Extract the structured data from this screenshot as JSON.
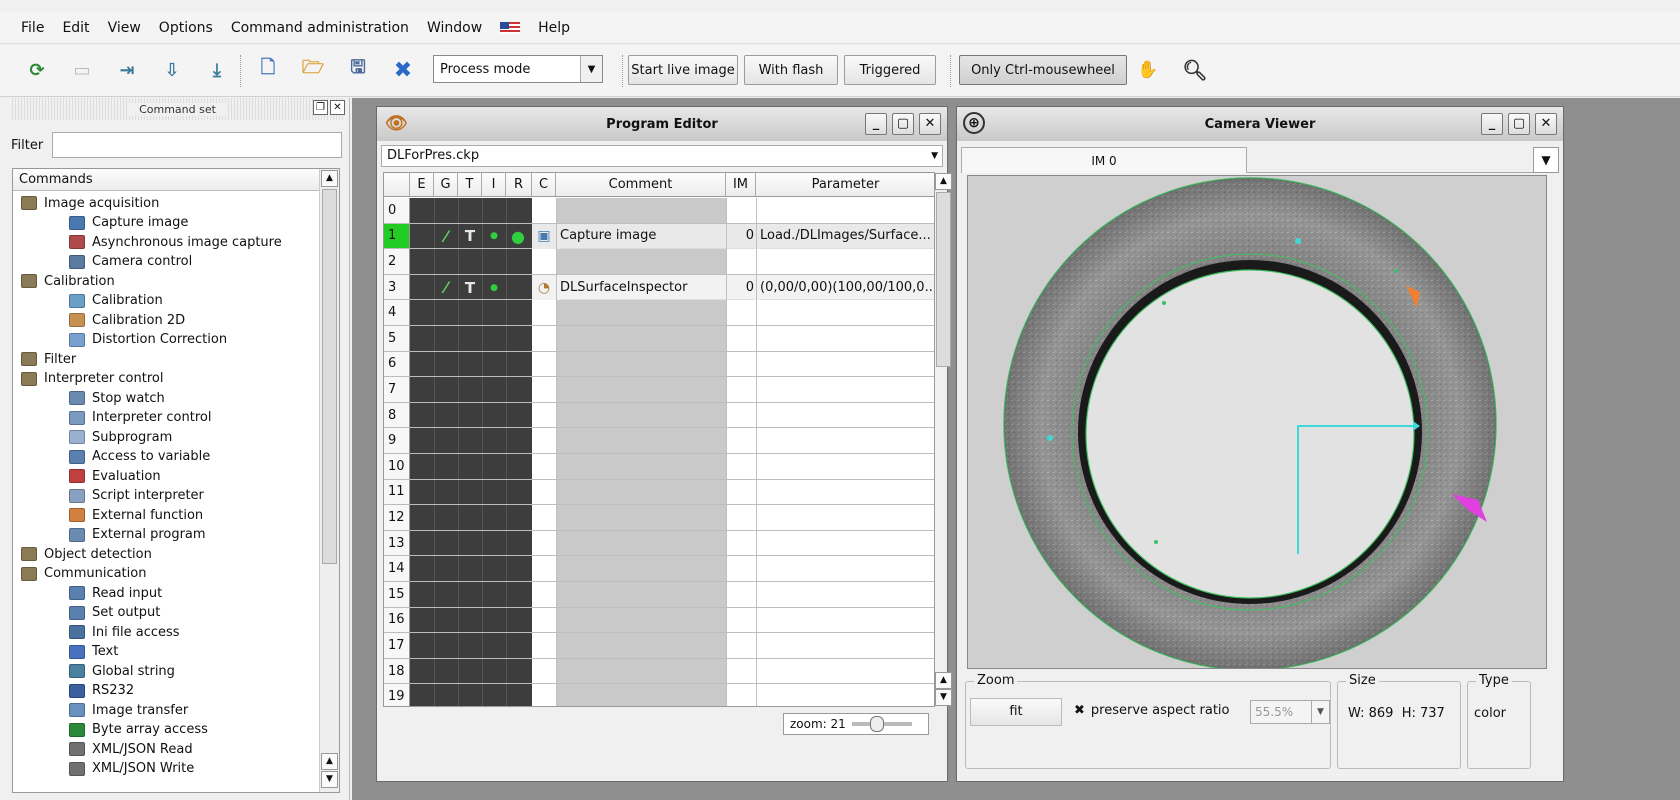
{
  "menu": {
    "items": [
      "File",
      "Edit",
      "View",
      "Options",
      "Command administration",
      "Window",
      "Help"
    ],
    "flag_icon": "us-flag-icon"
  },
  "toolbar": {
    "mode_select": "Process mode",
    "start_live_image": "Start live image",
    "with_flash": "With flash",
    "triggered": "Triggered",
    "only_ctrl_mousewheel": "Only Ctrl-mousewheel"
  },
  "command_set": {
    "title": "Command set",
    "filter_label": "Filter",
    "filter_value": "",
    "header": "Commands",
    "tree": [
      {
        "label": "Image acquisition",
        "level": 0,
        "icon": "folder-icon",
        "color": "#8a7a55"
      },
      {
        "label": "Capture image",
        "level": 1,
        "icon": "camera-icon",
        "color": "#4a78b0"
      },
      {
        "label": "Asynchronous image capture",
        "level": 1,
        "icon": "async-camera-icon",
        "color": "#b04a4a"
      },
      {
        "label": "Camera control",
        "level": 1,
        "icon": "camera-control-icon",
        "color": "#5a7aa0"
      },
      {
        "label": "Calibration",
        "level": 0,
        "icon": "folder-icon",
        "color": "#8a7a55"
      },
      {
        "label": "Calibration",
        "level": 1,
        "icon": "calibration-icon",
        "color": "#6aa0c8"
      },
      {
        "label": "Calibration 2D",
        "level": 1,
        "icon": "calibration-2d-icon",
        "color": "#c89050"
      },
      {
        "label": "Distortion Correction",
        "level": 1,
        "icon": "grid-icon",
        "color": "#7aa0d0"
      },
      {
        "label": "Filter",
        "level": 0,
        "icon": "folder-icon",
        "color": "#8a7a55"
      },
      {
        "label": "Interpreter control",
        "level": 0,
        "icon": "folder-icon",
        "color": "#8a7a55"
      },
      {
        "label": "Stop watch",
        "level": 1,
        "icon": "stopwatch-icon",
        "color": "#6a8ab0"
      },
      {
        "label": "Interpreter control",
        "level": 1,
        "icon": "interpreter-icon",
        "color": "#7a9ac0"
      },
      {
        "label": "Subprogram",
        "level": 1,
        "icon": "subprogram-icon",
        "color": "#9ab0d0"
      },
      {
        "label": "Access to variable",
        "level": 1,
        "icon": "variable-icon",
        "color": "#5a80b0"
      },
      {
        "label": "Evaluation",
        "level": 1,
        "icon": "evaluation-icon",
        "color": "#c04040"
      },
      {
        "label": "Script interpreter",
        "level": 1,
        "icon": "script-icon",
        "color": "#8aa0c0"
      },
      {
        "label": "External function",
        "level": 1,
        "icon": "external-function-icon",
        "color": "#d08040"
      },
      {
        "label": "External program",
        "level": 1,
        "icon": "external-program-icon",
        "color": "#6a8ab0"
      },
      {
        "label": "Object detection",
        "level": 0,
        "icon": "folder-icon",
        "color": "#8a7a55"
      },
      {
        "label": "Communication",
        "level": 0,
        "icon": "folder-icon",
        "color": "#8a7a55"
      },
      {
        "label": "Read input",
        "level": 1,
        "icon": "read-input-icon",
        "color": "#5a80b0"
      },
      {
        "label": "Set output",
        "level": 1,
        "icon": "set-output-icon",
        "color": "#5a80b0"
      },
      {
        "label": "Ini file access",
        "level": 1,
        "icon": "ini-file-icon",
        "color": "#4a70a0"
      },
      {
        "label": "Text",
        "level": 1,
        "icon": "text-icon",
        "color": "#4a70c0"
      },
      {
        "label": "Global string",
        "level": 1,
        "icon": "global-string-icon",
        "color": "#4a80a0"
      },
      {
        "label": "RS232",
        "level": 1,
        "icon": "rs232-icon",
        "color": "#3a60a0"
      },
      {
        "label": "Image transfer",
        "level": 1,
        "icon": "image-transfer-icon",
        "color": "#6a90c0"
      },
      {
        "label": "Byte array access",
        "level": 1,
        "icon": "byte-array-icon",
        "color": "#2a8a3a"
      },
      {
        "label": "XML/JSON Read",
        "level": 1,
        "icon": "xml-read-icon",
        "color": "#707070"
      },
      {
        "label": "XML/JSON Write",
        "level": 1,
        "icon": "xml-write-icon",
        "color": "#707070"
      }
    ]
  },
  "program_editor": {
    "title": "Program Editor",
    "file": "DLForPres.ckp",
    "columns": [
      "E",
      "G",
      "T",
      "I",
      "R",
      "C",
      "Comment",
      "IM",
      "Parameter"
    ],
    "rows": [
      {
        "n": "0",
        "comment": "",
        "im": "",
        "param": "",
        "g": false,
        "t": false,
        "i": false,
        "r": false,
        "c": ""
      },
      {
        "n": "1",
        "comment": "Capture image",
        "im": "0",
        "param": "Load./DLImages/Surface...",
        "g": true,
        "t": true,
        "i": true,
        "r": true,
        "c": "camera-icon"
      },
      {
        "n": "2",
        "comment": "",
        "im": "",
        "param": "",
        "g": false,
        "t": false,
        "i": false,
        "r": false,
        "c": ""
      },
      {
        "n": "3",
        "comment": "DLSurfaceInspector",
        "im": "0",
        "param": "(0,00/0,00)(100,00/100,0...",
        "g": true,
        "t": true,
        "i": true,
        "r": false,
        "c": "inspector-icon"
      },
      {
        "n": "4"
      },
      {
        "n": "5"
      },
      {
        "n": "6"
      },
      {
        "n": "7"
      },
      {
        "n": "8"
      },
      {
        "n": "9"
      },
      {
        "n": "10"
      },
      {
        "n": "11"
      },
      {
        "n": "12"
      },
      {
        "n": "13"
      },
      {
        "n": "14"
      },
      {
        "n": "15"
      },
      {
        "n": "16"
      },
      {
        "n": "17"
      },
      {
        "n": "18"
      },
      {
        "n": "19"
      }
    ],
    "zoom_label": "zoom: 21"
  },
  "camera_viewer": {
    "title": "Camera Viewer",
    "tab": "IM 0",
    "zoom_group": "Zoom",
    "fit_button": "fit",
    "preserve_aspect": "preserve aspect ratio",
    "zoom_percent": "55.5%",
    "size_group": "Size",
    "size_w": "W: 869",
    "size_h": "H: 737",
    "type_group": "Type",
    "type_value": "color"
  },
  "colors": {
    "selected_row": "#22cc22",
    "annotation_cyan": "#3fd8d8",
    "annotation_orange": "#f08030",
    "annotation_magenta": "#e040e0",
    "contour_green": "#3fbf60"
  }
}
